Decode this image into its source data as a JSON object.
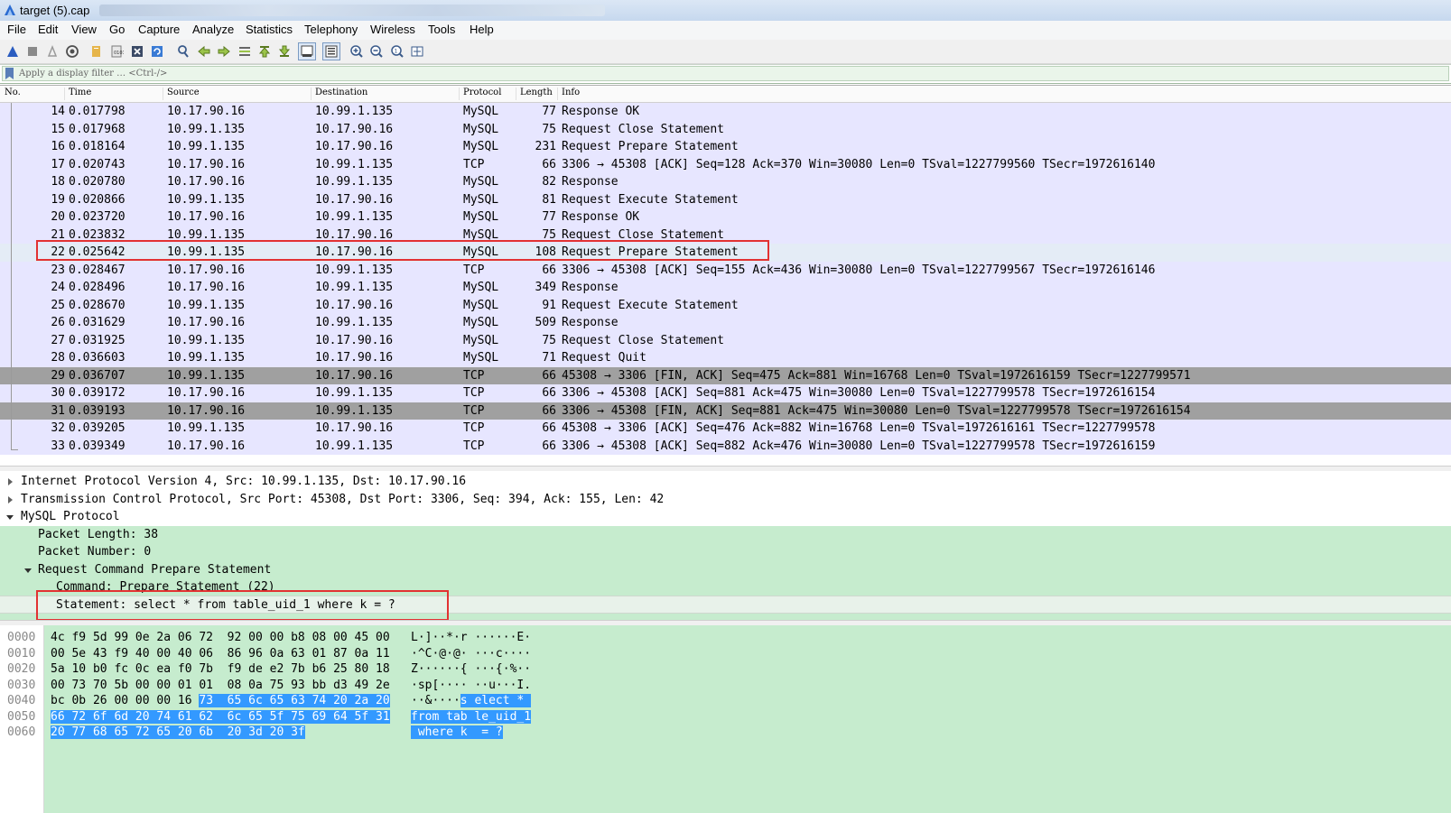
{
  "window": {
    "title": "target (5).cap"
  },
  "menu": [
    "File",
    "Edit",
    "View",
    "Go",
    "Capture",
    "Analyze",
    "Statistics",
    "Telephony",
    "Wireless",
    "Tools",
    "Help"
  ],
  "filter": {
    "placeholder": "Apply a display filter … <Ctrl-/>"
  },
  "columns": [
    "No.",
    "Time",
    "Source",
    "Destination",
    "Protocol",
    "Length",
    "Info"
  ],
  "packets": [
    {
      "no": "14",
      "time": "0.017798",
      "src": "10.17.90.16",
      "dst": "10.99.1.135",
      "proto": "MySQL",
      "len": "77",
      "info": "Response OK"
    },
    {
      "no": "15",
      "time": "0.017968",
      "src": "10.99.1.135",
      "dst": "10.17.90.16",
      "proto": "MySQL",
      "len": "75",
      "info": "Request Close Statement"
    },
    {
      "no": "16",
      "time": "0.018164",
      "src": "10.99.1.135",
      "dst": "10.17.90.16",
      "proto": "MySQL",
      "len": "231",
      "info": "Request Prepare Statement"
    },
    {
      "no": "17",
      "time": "0.020743",
      "src": "10.17.90.16",
      "dst": "10.99.1.135",
      "proto": "TCP",
      "len": "66",
      "info": "3306 → 45308 [ACK] Seq=128 Ack=370 Win=30080 Len=0 TSval=1227799560 TSecr=1972616140"
    },
    {
      "no": "18",
      "time": "0.020780",
      "src": "10.17.90.16",
      "dst": "10.99.1.135",
      "proto": "MySQL",
      "len": "82",
      "info": "Response"
    },
    {
      "no": "19",
      "time": "0.020866",
      "src": "10.99.1.135",
      "dst": "10.17.90.16",
      "proto": "MySQL",
      "len": "81",
      "info": "Request Execute Statement"
    },
    {
      "no": "20",
      "time": "0.023720",
      "src": "10.17.90.16",
      "dst": "10.99.1.135",
      "proto": "MySQL",
      "len": "77",
      "info": "Response OK"
    },
    {
      "no": "21",
      "time": "0.023832",
      "src": "10.99.1.135",
      "dst": "10.17.90.16",
      "proto": "MySQL",
      "len": "75",
      "info": "Request Close Statement"
    },
    {
      "no": "22",
      "time": "0.025642",
      "src": "10.99.1.135",
      "dst": "10.17.90.16",
      "proto": "MySQL",
      "len": "108",
      "info": "Request Prepare Statement"
    },
    {
      "no": "23",
      "time": "0.028467",
      "src": "10.17.90.16",
      "dst": "10.99.1.135",
      "proto": "TCP",
      "len": "66",
      "info": "3306 → 45308 [ACK] Seq=155 Ack=436 Win=30080 Len=0 TSval=1227799567 TSecr=1972616146"
    },
    {
      "no": "24",
      "time": "0.028496",
      "src": "10.17.90.16",
      "dst": "10.99.1.135",
      "proto": "MySQL",
      "len": "349",
      "info": "Response"
    },
    {
      "no": "25",
      "time": "0.028670",
      "src": "10.99.1.135",
      "dst": "10.17.90.16",
      "proto": "MySQL",
      "len": "91",
      "info": "Request Execute Statement"
    },
    {
      "no": "26",
      "time": "0.031629",
      "src": "10.17.90.16",
      "dst": "10.99.1.135",
      "proto": "MySQL",
      "len": "509",
      "info": "Response"
    },
    {
      "no": "27",
      "time": "0.031925",
      "src": "10.99.1.135",
      "dst": "10.17.90.16",
      "proto": "MySQL",
      "len": "75",
      "info": "Request Close Statement"
    },
    {
      "no": "28",
      "time": "0.036603",
      "src": "10.99.1.135",
      "dst": "10.17.90.16",
      "proto": "MySQL",
      "len": "71",
      "info": "Request Quit"
    },
    {
      "no": "29",
      "time": "0.036707",
      "src": "10.99.1.135",
      "dst": "10.17.90.16",
      "proto": "TCP",
      "len": "66",
      "info": "45308 → 3306 [FIN, ACK] Seq=475 Ack=881 Win=16768 Len=0 TSval=1972616159 TSecr=1227799571"
    },
    {
      "no": "30",
      "time": "0.039172",
      "src": "10.17.90.16",
      "dst": "10.99.1.135",
      "proto": "TCP",
      "len": "66",
      "info": "3306 → 45308 [ACK] Seq=881 Ack=475 Win=30080 Len=0 TSval=1227799578 TSecr=1972616154"
    },
    {
      "no": "31",
      "time": "0.039193",
      "src": "10.17.90.16",
      "dst": "10.99.1.135",
      "proto": "TCP",
      "len": "66",
      "info": "3306 → 45308 [FIN, ACK] Seq=881 Ack=475 Win=30080 Len=0 TSval=1227799578 TSecr=1972616154"
    },
    {
      "no": "32",
      "time": "0.039205",
      "src": "10.99.1.135",
      "dst": "10.17.90.16",
      "proto": "TCP",
      "len": "66",
      "info": "45308 → 3306 [ACK] Seq=476 Ack=882 Win=16768 Len=0 TSval=1972616161 TSecr=1227799578"
    },
    {
      "no": "33",
      "time": "0.039349",
      "src": "10.17.90.16",
      "dst": "10.99.1.135",
      "proto": "TCP",
      "len": "66",
      "info": "3306 → 45308 [ACK] Seq=882 Ack=476 Win=30080 Len=0 TSval=1227799578 TSecr=1972616159"
    }
  ],
  "details": [
    {
      "text": "Internet Protocol Version 4, Src: 10.99.1.135, Dst: 10.17.90.16",
      "expander": "collapsed"
    },
    {
      "text": "Transmission Control Protocol, Src Port: 45308, Dst Port: 3306, Seq: 394, Ack: 155, Len: 42",
      "expander": "collapsed"
    },
    {
      "text": "MySQL Protocol",
      "expander": "expanded"
    },
    {
      "text": "Packet Length: 38",
      "expander": "none"
    },
    {
      "text": "Packet Number: 0",
      "expander": "none"
    },
    {
      "text": "Request Command Prepare Statement",
      "expander": "expanded"
    },
    {
      "text": "Command: Prepare Statement (22)",
      "expander": "none"
    },
    {
      "text": "Statement: select * from table_uid_1 where k = ?",
      "expander": "none"
    }
  ],
  "bytes": [
    {
      "offset": "0000",
      "hex_plain": "4c f9 5d 99 0e 2a 06 72  92 00 00 b8 08 00 45 00",
      "hex_sel": "",
      "ascii_plain": "L·]··*·r ······E·",
      "ascii_sel": ""
    },
    {
      "offset": "0010",
      "hex_plain": "00 5e 43 f9 40 00 40 06  86 96 0a 63 01 87 0a 11",
      "hex_sel": "",
      "ascii_plain": "·^C·@·@· ···c····",
      "ascii_sel": ""
    },
    {
      "offset": "0020",
      "hex_plain": "5a 10 b0 fc 0c ea f0 7b  f9 de e2 7b b6 25 80 18",
      "hex_sel": "",
      "ascii_plain": "Z······{ ···{·%··",
      "ascii_sel": ""
    },
    {
      "offset": "0030",
      "hex_plain": "00 73 70 5b 00 00 01 01  08 0a 75 93 bb d3 49 2e",
      "hex_sel": "",
      "ascii_plain": "·sp[···· ··u···I.",
      "ascii_sel": ""
    },
    {
      "offset": "0040",
      "hex_plain": "bc 0b 26 00 00 00 16 ",
      "hex_sel": "73  65 6c 65 63 74 20 2a 20",
      "ascii_plain": "··&····",
      "ascii_sel": "s elect * "
    },
    {
      "offset": "0050",
      "hex_plain": "",
      "hex_sel": "66 72 6f 6d 20 74 61 62  6c 65 5f 75 69 64 5f 31",
      "ascii_plain": "",
      "ascii_sel": "from tab le_uid_1"
    },
    {
      "offset": "0060",
      "hex_plain": "",
      "hex_sel": "20 77 68 65 72 65 20 6b  20 3d 20 3f",
      "ascii_plain": "",
      "ascii_sel": " where k  = ?"
    }
  ]
}
